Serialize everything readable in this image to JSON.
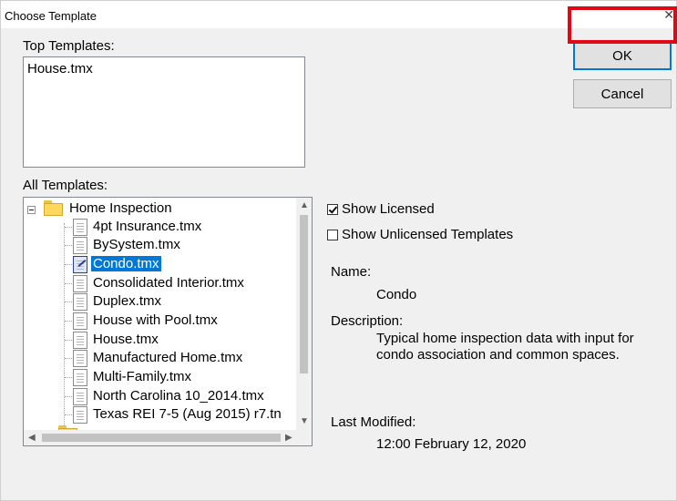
{
  "window": {
    "title": "Choose Template"
  },
  "labels": {
    "top_templates": "Top Templates:",
    "all_templates": "All Templates:"
  },
  "top_templates": [
    "House.tmx"
  ],
  "tree": {
    "root": "Home Inspection",
    "items": [
      {
        "label": "4pt Insurance.tmx",
        "selected": false
      },
      {
        "label": "BySystem.tmx",
        "selected": false
      },
      {
        "label": "Condo.tmx",
        "selected": true
      },
      {
        "label": "Consolidated Interior.tmx",
        "selected": false
      },
      {
        "label": "Duplex.tmx",
        "selected": false
      },
      {
        "label": "House with Pool.tmx",
        "selected": false
      },
      {
        "label": "House.tmx",
        "selected": false
      },
      {
        "label": "Manufactured Home.tmx",
        "selected": false
      },
      {
        "label": "Multi-Family.tmx",
        "selected": false
      },
      {
        "label": "North Carolina 10_2014.tmx",
        "selected": false
      },
      {
        "label": "Texas REI 7-5 (Aug 2015) r7.tn",
        "selected": false
      }
    ]
  },
  "buttons": {
    "ok": "OK",
    "cancel": "Cancel"
  },
  "options": {
    "show_licensed": {
      "label": "Show Licensed",
      "checked": true
    },
    "show_unlicensed": {
      "label": "Show Unlicensed Templates",
      "checked": false
    }
  },
  "details": {
    "name_label": "Name:",
    "name_value": "Condo",
    "description_label": "Description:",
    "description_value": "Typical home inspection data with input for condo association and common spaces.",
    "modified_label": "Last Modified:",
    "modified_value": "12:00 February 12, 2020"
  },
  "colors": {
    "selection": "#0078d7",
    "highlight": "#e30613",
    "dialog_bg": "#f0f0f0"
  }
}
